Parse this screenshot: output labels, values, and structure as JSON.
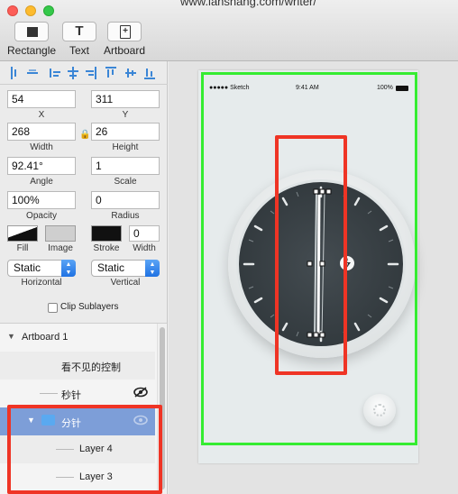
{
  "window": {
    "title": "www.lanshang.com/writer/"
  },
  "toolbar": {
    "items": [
      {
        "label": "Rectangle",
        "icon": "rectangle-icon"
      },
      {
        "label": "Text",
        "icon": "text-icon",
        "glyph": "T"
      },
      {
        "label": "Artboard",
        "icon": "artboard-icon"
      }
    ]
  },
  "inspector": {
    "x": {
      "value": "54",
      "label": "X"
    },
    "y": {
      "value": "311",
      "label": "Y"
    },
    "width": {
      "value": "268",
      "label": "Width"
    },
    "height": {
      "value": "26",
      "label": "Height"
    },
    "angle": {
      "value": "92.41°",
      "label": "Angle"
    },
    "scale": {
      "value": "1",
      "label": "Scale"
    },
    "opacity": {
      "value": "100%",
      "label": "Opacity"
    },
    "radius": {
      "value": "0",
      "label": "Radius"
    },
    "fill_label": "Fill",
    "image_label": "Image",
    "stroke_label": "Stroke",
    "stroke_width": {
      "value": "0",
      "label": "Width"
    },
    "horizontal": {
      "value": "Static",
      "label": "Horizontal"
    },
    "vertical": {
      "value": "Static",
      "label": "Vertical"
    },
    "clip_sublayers": "Clip Sublayers"
  },
  "layers": [
    {
      "name": "Artboard 1",
      "type": "artboard"
    },
    {
      "name": "看不见的控制",
      "type": "text"
    },
    {
      "name": "秒针",
      "type": "shape"
    },
    {
      "name": "分针",
      "type": "group",
      "selected": true
    },
    {
      "name": "Layer 4",
      "type": "shape"
    },
    {
      "name": "Layer 3",
      "type": "shape"
    }
  ],
  "artboard": {
    "status_carrier": "●●●●● Sketch",
    "status_time": "9:41 AM",
    "status_battery": "100%"
  },
  "colors": {
    "highlight_red": "#ef3425",
    "highlight_green": "#35ec31",
    "selection_blue": "#7d9ed8",
    "accent_blue": "#3b86d6"
  }
}
